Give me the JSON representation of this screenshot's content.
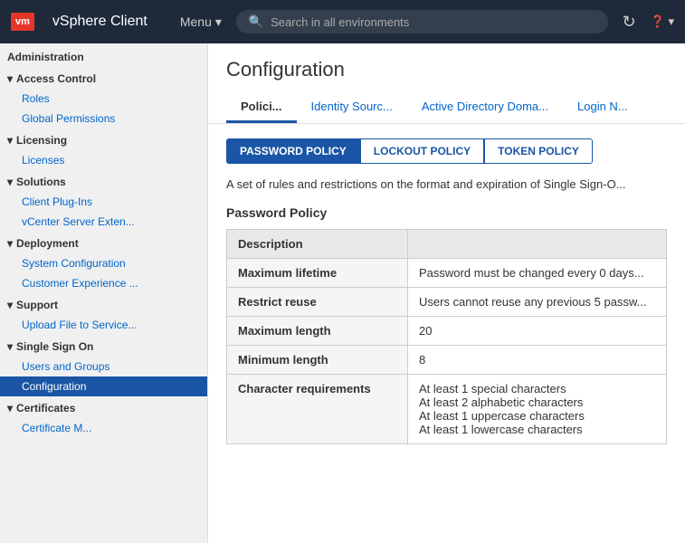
{
  "topbar": {
    "logo": "vm",
    "brand": "vSphere Client",
    "menu_label": "Menu",
    "search_placeholder": "Search in all environments"
  },
  "sidebar": {
    "sections": [
      {
        "label": "Administration",
        "type": "header"
      },
      {
        "label": "Access Control",
        "type": "toggle",
        "expanded": true,
        "items": [
          "Roles",
          "Global Permissions"
        ]
      },
      {
        "label": "Licensing",
        "type": "toggle",
        "expanded": true,
        "items": [
          "Licenses"
        ]
      },
      {
        "label": "Solutions",
        "type": "toggle",
        "expanded": true,
        "items": [
          "Client Plug-Ins",
          "vCenter Server Exten..."
        ]
      },
      {
        "label": "Deployment",
        "type": "toggle",
        "expanded": true,
        "items": [
          "System Configuration",
          "Customer Experience ..."
        ]
      },
      {
        "label": "Support",
        "type": "toggle",
        "expanded": true,
        "items": [
          "Upload File to Service..."
        ]
      },
      {
        "label": "Single Sign On",
        "type": "toggle",
        "expanded": true,
        "items": [
          "Users and Groups",
          "Configuration"
        ]
      },
      {
        "label": "Certificates",
        "type": "toggle",
        "expanded": true,
        "items": [
          "Certificate M..."
        ]
      }
    ]
  },
  "main": {
    "title": "Configuration",
    "tabs": [
      "Polici...",
      "Identity Sourc...",
      "Active Directory Doma...",
      "Login N..."
    ],
    "active_tab": 0,
    "policy_buttons": [
      "PASSWORD POLICY",
      "LOCKOUT POLICY",
      "TOKEN POLICY"
    ],
    "active_policy": 0,
    "description": "A set of rules and restrictions on the format and expiration of Single Sign-O...",
    "section_title": "Password Policy",
    "table_header": "Description",
    "table_rows": [
      {
        "label": "Maximum lifetime",
        "value": "Password must be changed every 0 days..."
      },
      {
        "label": "Restrict reuse",
        "value": "Users cannot reuse any previous 5 passw..."
      },
      {
        "label": "Maximum length",
        "value": "20"
      },
      {
        "label": "Minimum length",
        "value": "8"
      },
      {
        "label": "Character requirements",
        "value": "At least 1 special characters\nAt least 2 alphabetic characters\nAt least 1 uppercase characters\nAt least 1 lowercase characters"
      }
    ]
  }
}
